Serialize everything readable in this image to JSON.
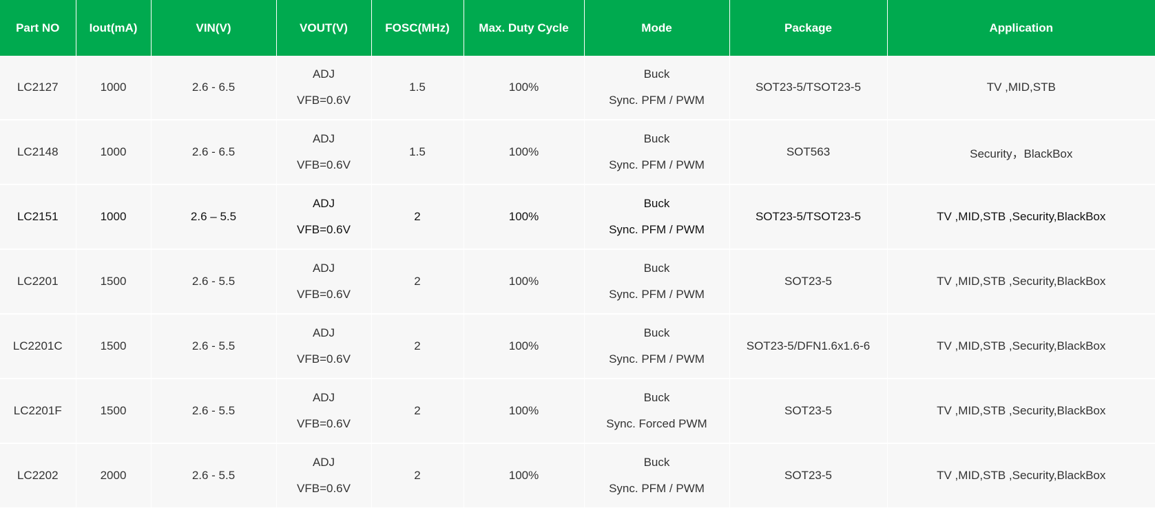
{
  "table": {
    "headers": [
      "Part NO",
      "Iout(mA)",
      "VIN(V)",
      "VOUT(V)",
      "FOSC(MHz)",
      "Max. Duty Cycle",
      "Mode",
      "Package",
      "Application"
    ],
    "rows": [
      {
        "part": "LC2127",
        "iout": "1000",
        "vin": "2.6 - 6.5",
        "vout_1": "ADJ",
        "vout_2": "VFB=0.6V",
        "fosc": "1.5",
        "duty": "100%",
        "mode_1": "Buck",
        "mode_2": "Sync. PFM / PWM",
        "package": "SOT23-5/TSOT23-5",
        "application": "TV ,MID,STB"
      },
      {
        "part": "LC2148",
        "iout": "1000",
        "vin": "2.6 - 6.5",
        "vout_1": "ADJ",
        "vout_2": "VFB=0.6V",
        "fosc": "1.5",
        "duty": "100%",
        "mode_1": "Buck",
        "mode_2": "Sync. PFM / PWM",
        "package": "SOT563",
        "application": "Security，BlackBox"
      },
      {
        "part": "LC2151",
        "iout": "1000",
        "vin": "2.6 – 5.5",
        "vout_1": "ADJ",
        "vout_2": "VFB=0.6V",
        "fosc": "2",
        "duty": "100%",
        "mode_1": "Buck",
        "mode_2": "Sync. PFM / PWM",
        "package": "SOT23-5/TSOT23-5",
        "application": "TV ,MID,STB ,Security,BlackBox"
      },
      {
        "part": "LC2201",
        "iout": "1500",
        "vin": "2.6 - 5.5",
        "vout_1": "ADJ",
        "vout_2": "VFB=0.6V",
        "fosc": "2",
        "duty": "100%",
        "mode_1": "Buck",
        "mode_2": "Sync. PFM / PWM",
        "package": "SOT23-5",
        "application": "TV ,MID,STB ,Security,BlackBox"
      },
      {
        "part": "LC2201C",
        "iout": "1500",
        "vin": "2.6 - 5.5",
        "vout_1": "ADJ",
        "vout_2": "VFB=0.6V",
        "fosc": "2",
        "duty": "100%",
        "mode_1": "Buck",
        "mode_2": "Sync. PFM / PWM",
        "package": "SOT23-5/DFN1.6x1.6-6",
        "application": "TV ,MID,STB ,Security,BlackBox"
      },
      {
        "part": "LC2201F",
        "iout": "1500",
        "vin": "2.6 - 5.5",
        "vout_1": "ADJ",
        "vout_2": "VFB=0.6V",
        "fosc": "2",
        "duty": "100%",
        "mode_1": "Buck",
        "mode_2": "Sync. Forced PWM",
        "package": "SOT23-5",
        "application": "TV ,MID,STB ,Security,BlackBox"
      },
      {
        "part": "LC2202",
        "iout": "2000",
        "vin": "2.6 - 5.5",
        "vout_1": "ADJ",
        "vout_2": "VFB=0.6V",
        "fosc": "2",
        "duty": "100%",
        "mode_1": "Buck",
        "mode_2": "Sync. PFM / PWM",
        "package": "SOT23-5",
        "application": "TV ,MID,STB ,Security,BlackBox"
      }
    ]
  },
  "colors": {
    "header_bg": "#00aa4f",
    "header_text": "#ffffff",
    "row_bg": "#f7f7f7",
    "cell_text": "#333333"
  }
}
